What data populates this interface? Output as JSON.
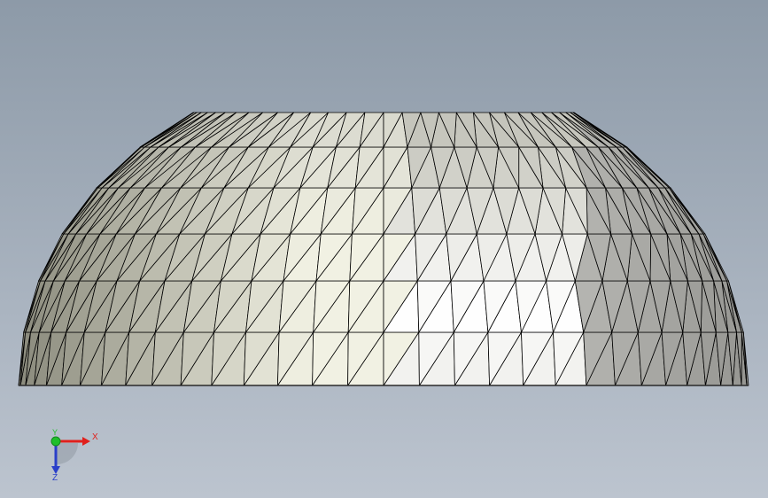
{
  "viewport": {
    "background_top": "#8d9aa8",
    "background_bottom": "#bcc4cf",
    "model_shading": {
      "highlight": "#ffffff",
      "light_warm": "#f1f1e3",
      "mid": "#d2d2c8",
      "shadow": "#8a8a7c",
      "edge_color": "#000000"
    }
  },
  "triad": {
    "x_label": "X",
    "y_label": "Y",
    "z_label": "Z",
    "x_color": "#e0201c",
    "y_color": "#1fbf2a",
    "z_color": "#2a3fc9"
  }
}
